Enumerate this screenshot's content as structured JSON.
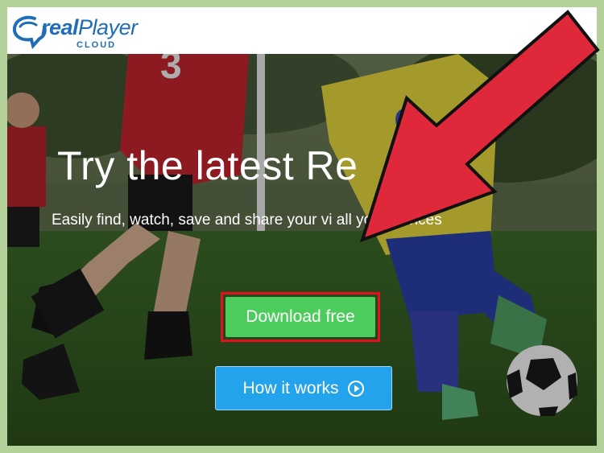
{
  "brand": {
    "logo_main_prefix": "real",
    "logo_main_suffix": "Player",
    "logo_sub": "CLOUD",
    "color": "#1e6db6"
  },
  "hero": {
    "title": "Try the latest Re",
    "subtitle": "Easily find, watch, save and share your vi          all your devices"
  },
  "buttons": {
    "download_label": "Download free",
    "download_color": "#4ccc5c",
    "how_label": "How it works",
    "how_color": "#22a3ec"
  },
  "annotation": {
    "highlight_color": "#e0121e",
    "arrow_color": "#e0283b"
  },
  "icons": {
    "logo": "realplayer-logo-icon",
    "play": "play-circle-icon",
    "arrow": "pointer-arrow-icon"
  }
}
